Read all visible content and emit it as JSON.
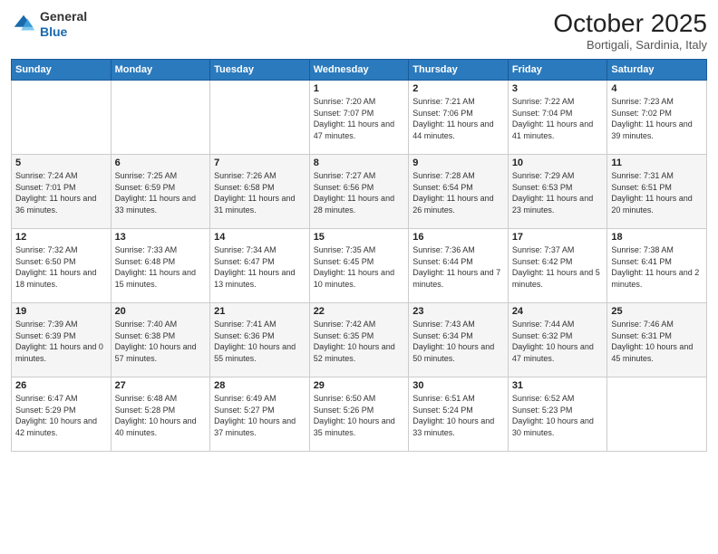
{
  "header": {
    "logo_general": "General",
    "logo_blue": "Blue",
    "month_title": "October 2025",
    "location": "Bortigali, Sardinia, Italy"
  },
  "days_of_week": [
    "Sunday",
    "Monday",
    "Tuesday",
    "Wednesday",
    "Thursday",
    "Friday",
    "Saturday"
  ],
  "weeks": [
    [
      {
        "day": "",
        "info": ""
      },
      {
        "day": "",
        "info": ""
      },
      {
        "day": "",
        "info": ""
      },
      {
        "day": "1",
        "info": "Sunrise: 7:20 AM\nSunset: 7:07 PM\nDaylight: 11 hours and 47 minutes."
      },
      {
        "day": "2",
        "info": "Sunrise: 7:21 AM\nSunset: 7:06 PM\nDaylight: 11 hours and 44 minutes."
      },
      {
        "day": "3",
        "info": "Sunrise: 7:22 AM\nSunset: 7:04 PM\nDaylight: 11 hours and 41 minutes."
      },
      {
        "day": "4",
        "info": "Sunrise: 7:23 AM\nSunset: 7:02 PM\nDaylight: 11 hours and 39 minutes."
      }
    ],
    [
      {
        "day": "5",
        "info": "Sunrise: 7:24 AM\nSunset: 7:01 PM\nDaylight: 11 hours and 36 minutes."
      },
      {
        "day": "6",
        "info": "Sunrise: 7:25 AM\nSunset: 6:59 PM\nDaylight: 11 hours and 33 minutes."
      },
      {
        "day": "7",
        "info": "Sunrise: 7:26 AM\nSunset: 6:58 PM\nDaylight: 11 hours and 31 minutes."
      },
      {
        "day": "8",
        "info": "Sunrise: 7:27 AM\nSunset: 6:56 PM\nDaylight: 11 hours and 28 minutes."
      },
      {
        "day": "9",
        "info": "Sunrise: 7:28 AM\nSunset: 6:54 PM\nDaylight: 11 hours and 26 minutes."
      },
      {
        "day": "10",
        "info": "Sunrise: 7:29 AM\nSunset: 6:53 PM\nDaylight: 11 hours and 23 minutes."
      },
      {
        "day": "11",
        "info": "Sunrise: 7:31 AM\nSunset: 6:51 PM\nDaylight: 11 hours and 20 minutes."
      }
    ],
    [
      {
        "day": "12",
        "info": "Sunrise: 7:32 AM\nSunset: 6:50 PM\nDaylight: 11 hours and 18 minutes."
      },
      {
        "day": "13",
        "info": "Sunrise: 7:33 AM\nSunset: 6:48 PM\nDaylight: 11 hours and 15 minutes."
      },
      {
        "day": "14",
        "info": "Sunrise: 7:34 AM\nSunset: 6:47 PM\nDaylight: 11 hours and 13 minutes."
      },
      {
        "day": "15",
        "info": "Sunrise: 7:35 AM\nSunset: 6:45 PM\nDaylight: 11 hours and 10 minutes."
      },
      {
        "day": "16",
        "info": "Sunrise: 7:36 AM\nSunset: 6:44 PM\nDaylight: 11 hours and 7 minutes."
      },
      {
        "day": "17",
        "info": "Sunrise: 7:37 AM\nSunset: 6:42 PM\nDaylight: 11 hours and 5 minutes."
      },
      {
        "day": "18",
        "info": "Sunrise: 7:38 AM\nSunset: 6:41 PM\nDaylight: 11 hours and 2 minutes."
      }
    ],
    [
      {
        "day": "19",
        "info": "Sunrise: 7:39 AM\nSunset: 6:39 PM\nDaylight: 11 hours and 0 minutes."
      },
      {
        "day": "20",
        "info": "Sunrise: 7:40 AM\nSunset: 6:38 PM\nDaylight: 10 hours and 57 minutes."
      },
      {
        "day": "21",
        "info": "Sunrise: 7:41 AM\nSunset: 6:36 PM\nDaylight: 10 hours and 55 minutes."
      },
      {
        "day": "22",
        "info": "Sunrise: 7:42 AM\nSunset: 6:35 PM\nDaylight: 10 hours and 52 minutes."
      },
      {
        "day": "23",
        "info": "Sunrise: 7:43 AM\nSunset: 6:34 PM\nDaylight: 10 hours and 50 minutes."
      },
      {
        "day": "24",
        "info": "Sunrise: 7:44 AM\nSunset: 6:32 PM\nDaylight: 10 hours and 47 minutes."
      },
      {
        "day": "25",
        "info": "Sunrise: 7:46 AM\nSunset: 6:31 PM\nDaylight: 10 hours and 45 minutes."
      }
    ],
    [
      {
        "day": "26",
        "info": "Sunrise: 6:47 AM\nSunset: 5:29 PM\nDaylight: 10 hours and 42 minutes."
      },
      {
        "day": "27",
        "info": "Sunrise: 6:48 AM\nSunset: 5:28 PM\nDaylight: 10 hours and 40 minutes."
      },
      {
        "day": "28",
        "info": "Sunrise: 6:49 AM\nSunset: 5:27 PM\nDaylight: 10 hours and 37 minutes."
      },
      {
        "day": "29",
        "info": "Sunrise: 6:50 AM\nSunset: 5:26 PM\nDaylight: 10 hours and 35 minutes."
      },
      {
        "day": "30",
        "info": "Sunrise: 6:51 AM\nSunset: 5:24 PM\nDaylight: 10 hours and 33 minutes."
      },
      {
        "day": "31",
        "info": "Sunrise: 6:52 AM\nSunset: 5:23 PM\nDaylight: 10 hours and 30 minutes."
      },
      {
        "day": "",
        "info": ""
      }
    ]
  ]
}
